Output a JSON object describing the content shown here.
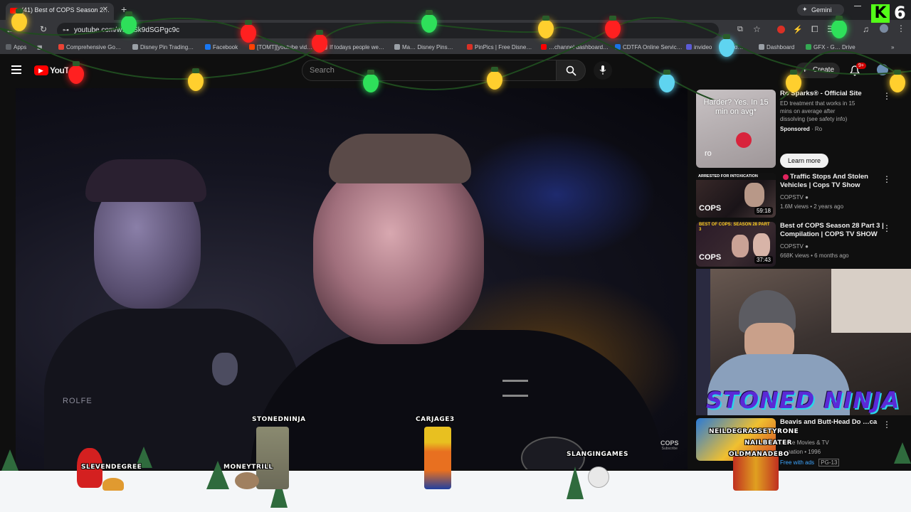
{
  "browser": {
    "tab_title": "(41) Best of COPS Season 2…",
    "new_tab": "+",
    "url": "youtube.com/w…=Sk9dSGPgc9c",
    "gemini": "Gemini",
    "bookmarks": [
      {
        "label": "Apps",
        "color": "#5f6368"
      },
      {
        "label": "Comprehensive Go…",
        "color": "#ea4335"
      },
      {
        "label": "Disney Pin Trading…",
        "color": "#9aa0a6"
      },
      {
        "label": "Facebook",
        "color": "#1877f2"
      },
      {
        "label": "[TOMT][youtube vid…",
        "color": "#ff4500"
      },
      {
        "label": "If todays people we…",
        "color": "#9aa0a6"
      },
      {
        "label": "Ma… Disney Pins…",
        "color": "#9aa0a6"
      },
      {
        "label": "PinPics | Free Disne…",
        "color": "#d93025"
      },
      {
        "label": "…channel dashboard…",
        "color": "#ff0000"
      },
      {
        "label": "CDTFA Online Servic…",
        "color": "#1a73e8"
      },
      {
        "label": "invideo",
        "color": "#5b5bd6"
      },
      {
        "label": "id…",
        "color": "#9aa0a6"
      },
      {
        "label": "Dashboard",
        "color": "#9aa0a6"
      },
      {
        "label": "GFX - G… Drive",
        "color": "#34a853"
      }
    ]
  },
  "youtube": {
    "logo": "YouTube",
    "search_placeholder": "Search",
    "create_label": "Create",
    "notif_badge": "9+"
  },
  "video": {
    "name_tag": "ROLFE",
    "watermark": "COPS",
    "watermark_sub": "Subscribe"
  },
  "sidebar": {
    "ad": {
      "thumb_text": "Harder? Yes. In 15 min on avg*",
      "thumb_brand": "ro",
      "title": "Ro Sparks® - Official Site",
      "desc": "ED treatment that works in 15 mins on average after dissolving (see safety info)",
      "sponsored": "Sponsored",
      "advertiser": "Ro",
      "cta": "Learn more"
    },
    "videos": [
      {
        "thumb_banner": "ARRESTED FOR INTOXICATION",
        "thumb_logo": "COPS",
        "duration": "59:18",
        "title": "Traffic Stops And Stolen Vehicles | Cops TV Show",
        "channel": "COPSTV",
        "meta": "1.6M views • 2 years ago"
      },
      {
        "thumb_banner": "BEST OF COPS: SEASON 28 PART 3",
        "thumb_logo": "COPS",
        "duration": "37:43",
        "title": "Best of COPS Season 28 Part 3 | Compilation | COPS TV SHOW",
        "channel": "COPSTV",
        "meta": "668K views • 6 months ago"
      },
      {
        "thumb_banner": "",
        "thumb_logo": "",
        "duration": "",
        "title": "Beavis and Butt-Head Do …ca",
        "channel": "…ube Movies & TV",
        "meta": "…mation • 1996",
        "free_label": "Free with ads",
        "rating": "PG-13"
      }
    ]
  },
  "overlay": {
    "streamer_banner": "STONED NINJA",
    "corner_badge": "6",
    "usernames": [
      "STONEDNINJA",
      "CARJAGE3",
      "SLEVENDEGREE",
      "MONEYTRILL",
      "SLANGINGAMES",
      "NEILDEGRASSETYRONE",
      "NAILBEATER",
      "OLDMANADEBO"
    ],
    "light_colors": [
      "#ffcf2e",
      "#2ee05a",
      "#ff2020",
      "#5fd4f0"
    ]
  }
}
